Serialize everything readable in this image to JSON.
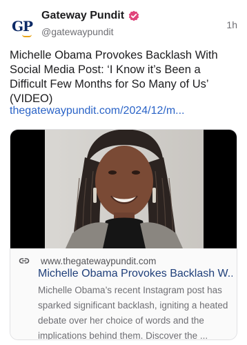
{
  "author": {
    "name": "Gateway Pundit",
    "handle": "@gatewaypundit",
    "avatar_text": "GP",
    "verified_color": "#e0457b"
  },
  "time_ago": "1h",
  "post_text": "Michelle Obama Provokes Backlash With Social Media Post: ‘I Know it’s Been a Difficult Few Months for So Many of Us’ (VIDEO)",
  "link_text": "thegatewaypundit.com/2024/12/m...",
  "card": {
    "domain": "www.thegatewaypundit.com",
    "title": "Michelle Obama Provokes Backlash W...",
    "description": "Michelle Obama’s recent Instagram post has sparked significant backlash, igniting a heated debate over her choice of words and the implications behind them. Discover the ...",
    "icons": [
      "link-icon"
    ]
  },
  "colors": {
    "link": "#2a63c7",
    "card_title": "#1f3f7a",
    "muted": "#6e6e73"
  }
}
